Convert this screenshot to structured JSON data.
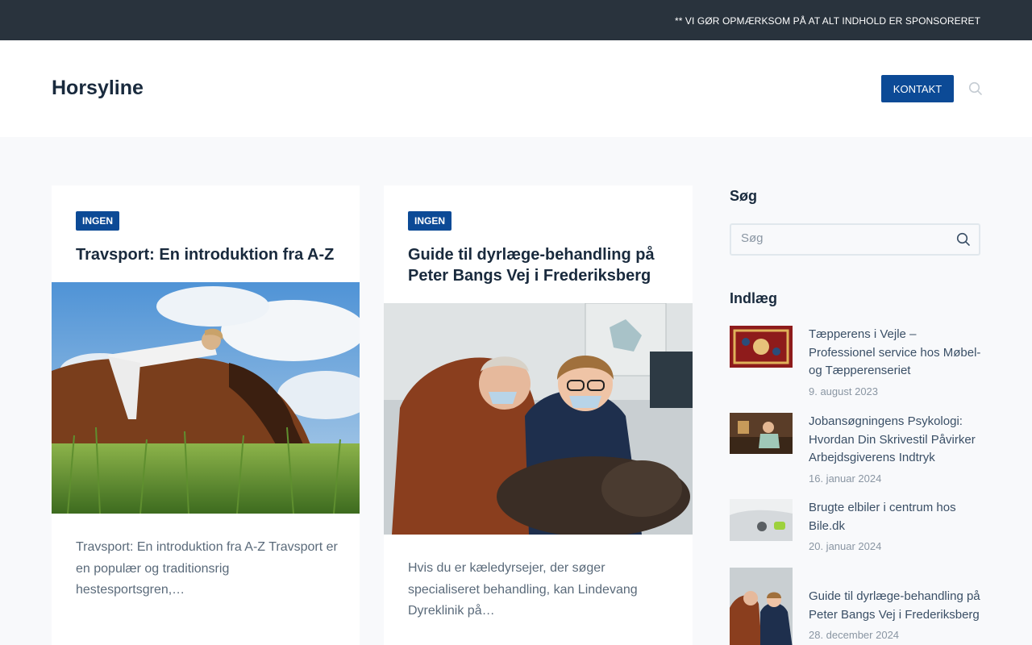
{
  "topbar": {
    "notice": "** VI GØR OPMÆRKSOM PÅ AT ALT INDHOLD ER SPONSORERET"
  },
  "header": {
    "site_title": "Horsyline",
    "contact_label": "KONTAKT"
  },
  "articles": [
    {
      "category": "INGEN",
      "title": "Travsport: En introduktion fra A-Z",
      "image": "woman-lying-on-horse-photo",
      "excerpt": "Travsport: En introduktion fra A-Z Travsport er en populær og traditionsrig hestesportsgren,…"
    },
    {
      "category": "INGEN",
      "title": "Guide til dyrlæge-behandling på Peter Bangs Vej i Frederiksberg",
      "image": "veterinarians-treating-cat-photo",
      "excerpt": "Hvis du er kæledyrsejer, der søger specialiseret behandling, kan Lindevang Dyreklinik på…"
    }
  ],
  "sidebar": {
    "search_title": "Søg",
    "search_placeholder": "Søg",
    "posts_title": "Indlæg",
    "posts": [
      {
        "title": "Tæpperens i Vejle – Professionel service hos Møbel- og Tæpperenseriet",
        "date": "9. august 2023",
        "image": "persian-rug-photo"
      },
      {
        "title": "Jobansøgningens Psykologi: Hvordan Din Skrivestil Påvirker Arbejdsgiverens Indtryk",
        "date": "16. januar 2024",
        "image": "woman-writing-at-desk-photo"
      },
      {
        "title": "Brugte elbiler i centrum hos Bile.dk",
        "date": "20. januar 2024",
        "image": "electric-car-charging-photo"
      },
      {
        "title": "Guide til dyrlæge-behandling på Peter Bangs Vej i Frederiksberg",
        "date": "28. december 2024",
        "image": "veterinarians-treating-cat-photo"
      }
    ]
  },
  "colors": {
    "accent": "#0c4a96",
    "topbar_bg": "#29333d",
    "heading": "#192a3d"
  }
}
